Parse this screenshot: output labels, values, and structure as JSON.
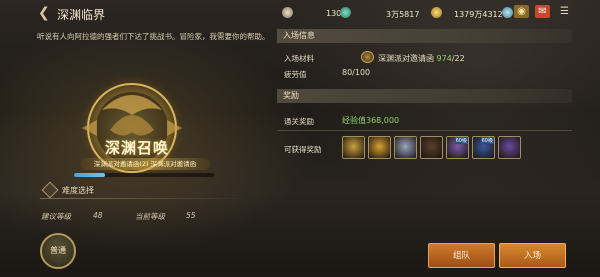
{
  "header": {
    "title": "深渊临界",
    "resources": [
      {
        "icon": "energy-icon",
        "value": "130"
      },
      {
        "icon": "gem-icon",
        "value": "3万5817"
      },
      {
        "icon": "gold-coin-icon",
        "value": "1379万4312"
      }
    ]
  },
  "description": "听说有人向阿拉德的强者们下达了挑战书。冒险家，我需要你的帮助。",
  "emblem": {
    "title": "深渊召唤",
    "subtitle": "深渊派对邀请函(2) 深渊派对邀请函"
  },
  "progress_fraction": 0.22,
  "difficulty": {
    "label": "难度选择",
    "recommended_label": "建议等级",
    "recommended_value": "48",
    "current_label": "当前等级",
    "current_value": "55",
    "mode_button": "普通"
  },
  "entry_info": {
    "section_title": "入场信息",
    "material_label": "入场材料",
    "material_name": "深渊派对邀请函",
    "material_have": "974",
    "material_need": "/22",
    "fatigue_label": "疲劳值",
    "fatigue_value": "80/100"
  },
  "rewards": {
    "section_title": "奖励",
    "clear_label": "通关奖励",
    "clear_value": "经验值368,000",
    "obtainable_label": "可获得奖励",
    "items": [
      {
        "icon": "gold-bars-icon",
        "color": "#c9a13a",
        "badge": ""
      },
      {
        "icon": "sun-orb-icon",
        "color": "#d8a030",
        "badge": ""
      },
      {
        "icon": "silver-disc-icon",
        "color": "#9aa6bd",
        "badge": ""
      },
      {
        "icon": "dark-chest-icon",
        "color": "#5a3f2a",
        "badge": ""
      },
      {
        "icon": "purple-crystal-icon",
        "color": "#7b5aa8",
        "badge": "60级"
      },
      {
        "icon": "blue-sword-icon",
        "color": "#3a5a9a",
        "badge": "60级"
      },
      {
        "icon": "purple-sword-icon",
        "color": "#6a4aa0",
        "badge": ""
      }
    ]
  },
  "buttons": {
    "team": "组队",
    "enter": "入场"
  }
}
